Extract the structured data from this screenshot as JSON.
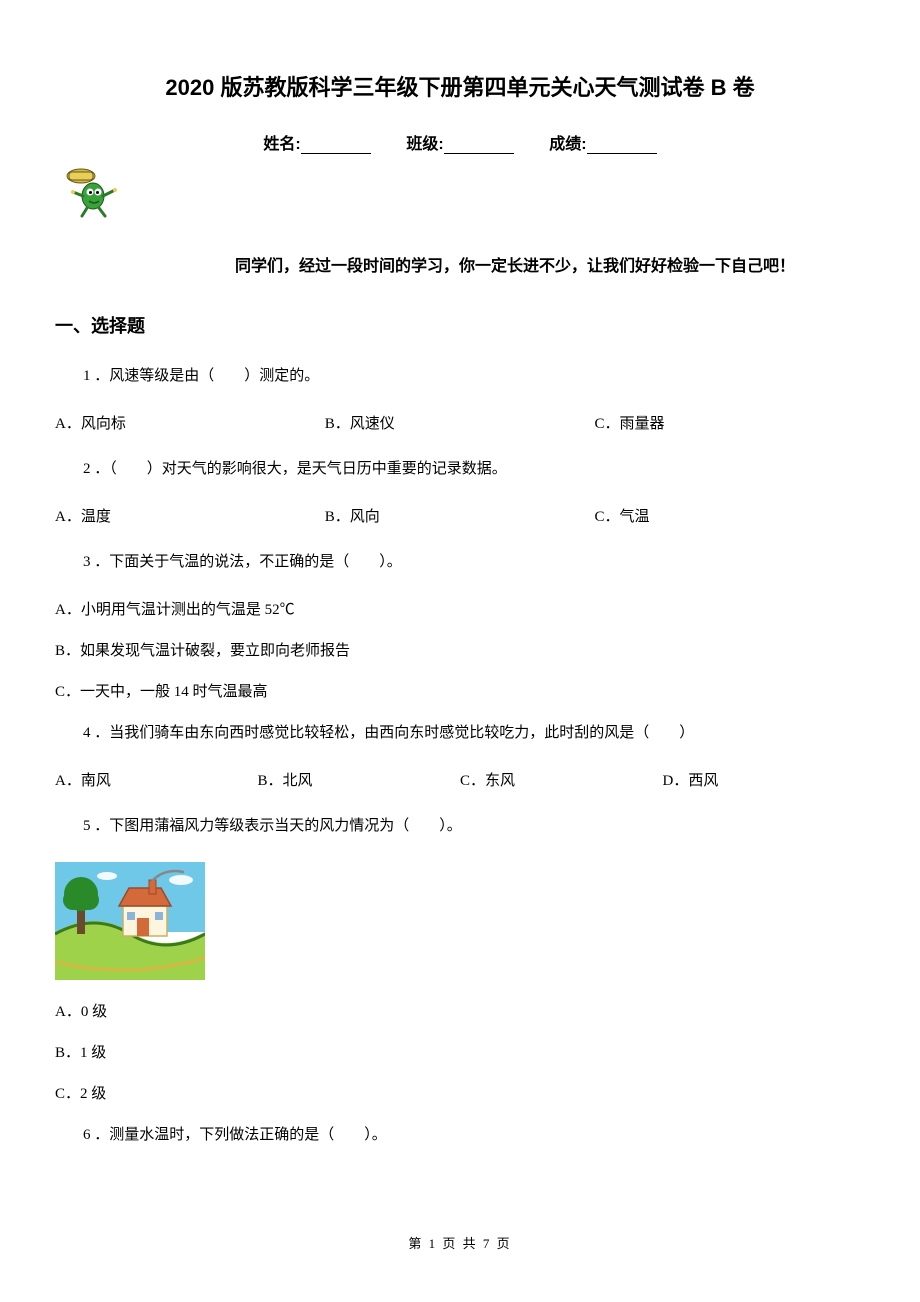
{
  "title": "2020 版苏教版科学三年级下册第四单元关心天气测试卷 B 卷",
  "form": {
    "name_label": "姓名:",
    "class_label": "班级:",
    "score_label": "成绩:"
  },
  "intro": "同学们，经过一段时间的学习，你一定长进不少，让我们好好检验一下自己吧！",
  "section1_heading": "一、选择题",
  "q1": {
    "text": "1 ．风速等级是由（　　）测定的。",
    "a": "A．风向标",
    "b": "B．风速仪",
    "c": "C．雨量器"
  },
  "q2": {
    "text": "2 ．（　　）对天气的影响很大，是天气日历中重要的记录数据。",
    "a": "A．温度",
    "b": "B．风向",
    "c": "C．气温"
  },
  "q3": {
    "text": "3 ．下面关于气温的说法，不正确的是（　　）。",
    "a": "A．小明用气温计测出的气温是 52℃",
    "b": "B．如果发现气温计破裂，要立即向老师报告",
    "c": "C．一天中，一般 14 时气温最高"
  },
  "q4": {
    "text": "4 ．当我们骑车由东向西时感觉比较轻松，由西向东时感觉比较吃力，此时刮的风是（　　）",
    "a": "A．南风",
    "b": "B．北风",
    "c": "C．东风",
    "d": "D．西风"
  },
  "q5": {
    "text": "5 ．下图用蒲福风力等级表示当天的风力情况为（　　）。",
    "a": "A．0 级",
    "b": "B．1 级",
    "c": "C．2 级"
  },
  "q6": {
    "text": "6 ．测量水温时，下列做法正确的是（　　）。"
  },
  "footer": "第 1 页 共 7 页"
}
